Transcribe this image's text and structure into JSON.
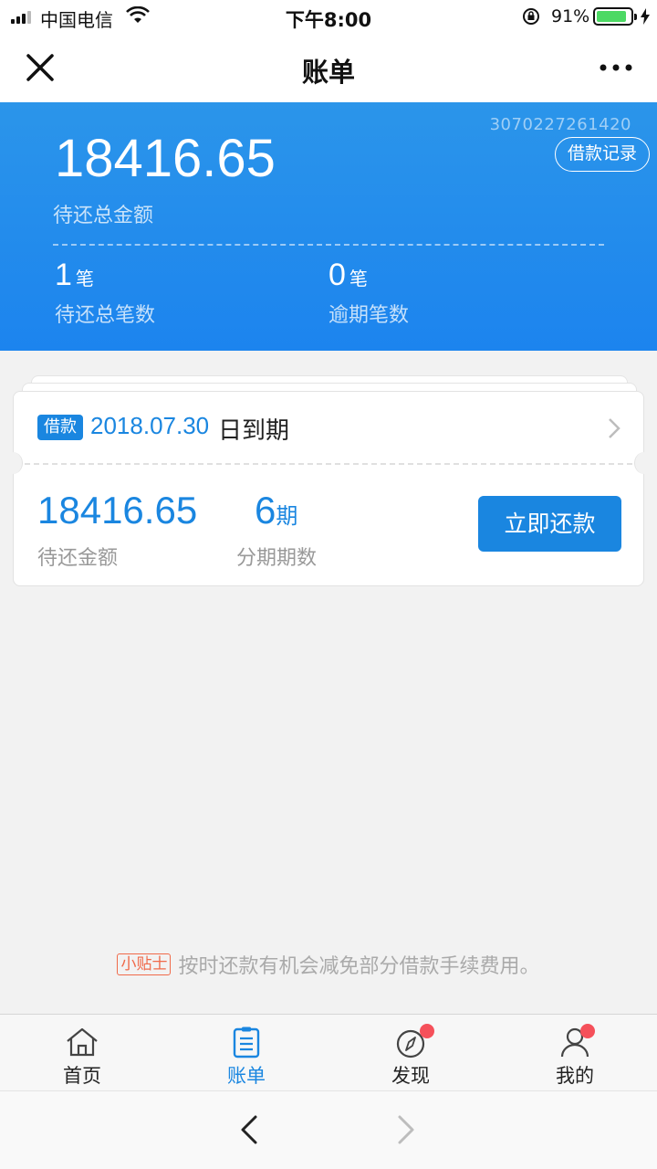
{
  "status_bar": {
    "carrier": "中国电信",
    "time": "下午8:00",
    "battery_percent": "91%",
    "battery_level": 0.91
  },
  "nav": {
    "title": "账单"
  },
  "summary": {
    "account_number": "3070227261420",
    "records_button": "借款记录",
    "total_amount": "18416.65",
    "total_amount_label": "待还总金额",
    "pending_count": "1",
    "pending_unit": "笔",
    "pending_label": "待还总笔数",
    "overdue_count": "0",
    "overdue_unit": "笔",
    "overdue_label": "逾期笔数"
  },
  "bill": {
    "tag": "借款",
    "due_date": "2018.07.30",
    "due_suffix": "日到期",
    "amount": "18416.65",
    "amount_label": "待还金额",
    "periods": "6",
    "periods_unit": "期",
    "periods_label": "分期期数",
    "repay_button": "立即还款"
  },
  "tip": {
    "tag": "小贴士",
    "text": "按时还款有机会减免部分借款手续费用。"
  },
  "tabs": [
    {
      "label": "首页",
      "icon": "home-icon",
      "active": false,
      "badge": false
    },
    {
      "label": "账单",
      "icon": "bill-icon",
      "active": true,
      "badge": false
    },
    {
      "label": "发现",
      "icon": "compass-icon",
      "active": false,
      "badge": true
    },
    {
      "label": "我的",
      "icon": "user-icon",
      "active": false,
      "badge": true
    }
  ],
  "colors": {
    "primary_blue": "#1a86e0",
    "header_blue": "#1c84ee",
    "badge_red": "#f5505a",
    "tip_orange": "#f06a4a"
  }
}
